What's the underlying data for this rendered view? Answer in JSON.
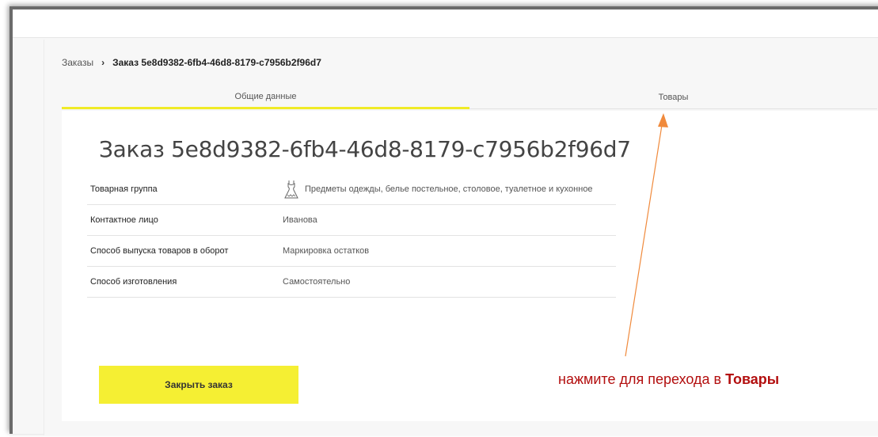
{
  "breadcrumb": {
    "root": "Заказы",
    "separator": "›",
    "current": "Заказ 5e8d9382-6fb4-46d8-8179-c7956b2f96d7"
  },
  "tabs": [
    {
      "label": "Общие данные",
      "active": true
    },
    {
      "label": "Товары",
      "active": false
    }
  ],
  "order": {
    "title": "Заказ 5e8d9382-6fb4-46d8-8179-c7956b2f96d7",
    "properties": [
      {
        "label": "Товарная группа",
        "value": "Предметы одежды, белье постельное, столовое, туалетное и кухонное",
        "icon": "dress-icon"
      },
      {
        "label": "Контактное лицо",
        "value": "Иванова"
      },
      {
        "label": "Способ выпуска товаров в оборот",
        "value": "Маркировка остатков"
      },
      {
        "label": "Способ изготовления",
        "value": "Самостоятельно"
      }
    ]
  },
  "actions": {
    "close_label": "Закрыть заказ"
  },
  "annotation": {
    "text": "нажмите для перехода в ",
    "emphasis": "Товары",
    "color": "#b30f0f",
    "arrow_color": "#f08a3c"
  },
  "colors": {
    "accent": "#f5ef33",
    "tab_underline": "#f0eb27"
  }
}
